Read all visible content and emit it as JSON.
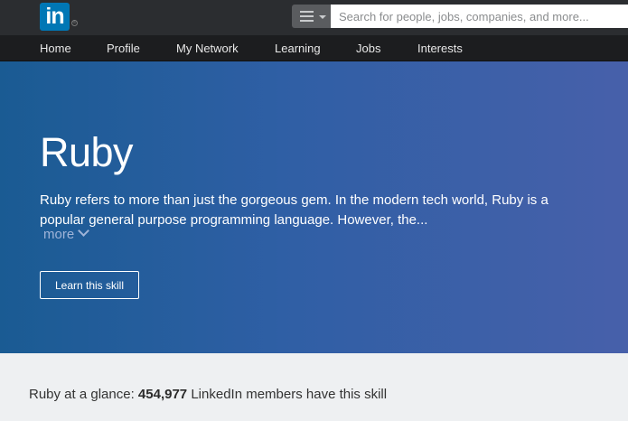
{
  "header": {
    "logo_text": "in",
    "logo_reg": "®",
    "search_placeholder": "Search for people, jobs, companies, and more...",
    "accent": "#0077b5"
  },
  "nav": {
    "items": [
      {
        "label": "Home"
      },
      {
        "label": "Profile"
      },
      {
        "label": "My Network"
      },
      {
        "label": "Learning"
      },
      {
        "label": "Jobs"
      },
      {
        "label": "Interests"
      }
    ]
  },
  "hero": {
    "title": "Ruby",
    "description": "Ruby refers to more than just the gorgeous gem. In the modern tech world, Ruby is a popular general purpose programming language. However, the...",
    "more_label": "more",
    "button_label": "Learn this skill"
  },
  "glance": {
    "prefix": "Ruby at a glance:",
    "count": "454,977",
    "suffix": "LinkedIn members have this skill"
  }
}
